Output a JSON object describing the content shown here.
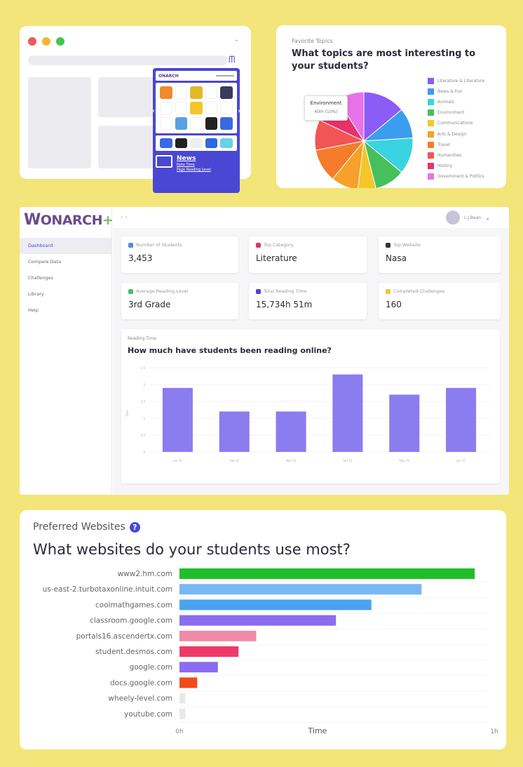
{
  "browser": {
    "ext_brand": "ONARCH",
    "news_title": "News",
    "news_sub1": "Note Time",
    "news_sub2": "Page Reading Level",
    "app_colors": [
      "#f08a2a",
      "#ffffff",
      "#e0b92a",
      "#ffffff",
      "#3a3a5a",
      "#ffffff",
      "#ffffff",
      "#f5c52a",
      "#ffffff",
      "#ffffff",
      "#ffffff",
      "#5aa0e6",
      "#ffffff",
      "#222222",
      "#3a6ae0"
    ],
    "row2_colors": [
      "#3a6ae0",
      "#222222",
      "#eeeeee",
      "#2a6ae0",
      "#6ad0e6"
    ]
  },
  "pie": {
    "label": "Favorite Topics",
    "title": "What topics are most interesting to your students?",
    "tooltip_name": "Environment",
    "tooltip_value": "40m (10%)",
    "legend": [
      {
        "label": "Literature & Literature",
        "color": "#8b5cf6"
      },
      {
        "label": "News & Fun",
        "color": "#3b9ded"
      },
      {
        "label": "Animals",
        "color": "#3ad3e0"
      },
      {
        "label": "Environment",
        "color": "#46c05a"
      },
      {
        "label": "Communications",
        "color": "#f5c52a"
      },
      {
        "label": "Arts & Design",
        "color": "#f5a12a"
      },
      {
        "label": "Travel",
        "color": "#f57c2a"
      },
      {
        "label": "Humanities",
        "color": "#f25555"
      },
      {
        "label": "History",
        "color": "#e8316a"
      },
      {
        "label": "Government & Politics",
        "color": "#e872e8"
      }
    ]
  },
  "dashboard": {
    "logo_main": "ONARCH",
    "logo_plus": "+",
    "nav": "‹   ›",
    "user_name": "L.J Bean",
    "sidebar": [
      "Dashboard",
      "Compare Data",
      "Challenges",
      "Library",
      "Help"
    ],
    "stats": [
      {
        "label": "Number of Students",
        "value": "3,453",
        "icon_color": "#4a90e2"
      },
      {
        "label": "Top Category",
        "value": "Literature",
        "icon_color": "#e8316a"
      },
      {
        "label": "Top Website",
        "value": "Nasa",
        "icon_color": "#333333"
      },
      {
        "label": "Average Reading Level",
        "value": "3rd Grade",
        "icon_color": "#46c05a"
      },
      {
        "label": "Total Reading Time",
        "value": "15,734h 51m",
        "icon_color": "#4a47d4"
      },
      {
        "label": "Completed Challenges",
        "value": "160",
        "icon_color": "#f5c52a"
      }
    ],
    "reading_label": "Reading Time",
    "reading_title": "How much have students been reading online?"
  },
  "chart_data": [
    {
      "type": "pie",
      "title": "What topics are most interesting to your students?",
      "categories": [
        "Literature & Literature",
        "News & Fun",
        "Animals",
        "Environment",
        "Communications",
        "Arts & Design",
        "Travel",
        "Humanities",
        "History",
        "Government & Politics"
      ],
      "values": [
        14,
        10,
        12,
        10,
        6,
        9,
        11,
        10,
        9,
        9
      ],
      "colors": [
        "#8b5cf6",
        "#3b9ded",
        "#3ad3e0",
        "#46c05a",
        "#f5c52a",
        "#f5a12a",
        "#f57c2a",
        "#f25555",
        "#e8316a",
        "#e872e8"
      ]
    },
    {
      "type": "bar",
      "title": "How much have students been reading online?",
      "categories": [
        "Jan 15",
        "Feb 15",
        "Mar 15",
        "Apr 15",
        "May 15",
        "Jun 15"
      ],
      "values": [
        1.9,
        1.2,
        1.2,
        2.3,
        1.7,
        1.9
      ],
      "ylim": [
        0,
        2.5
      ],
      "ylabel": "Time",
      "color": "#8b7cf0"
    },
    {
      "type": "bar",
      "orientation": "horizontal",
      "title": "What websites do your students use most?",
      "categories": [
        "www2.hm.com",
        "us-east-2.turbotaxonline.intuit.com",
        "coolmathgames.com",
        "classroom.google.com",
        "portals16.ascendertx.com",
        "student.desmos.com",
        "google.com",
        "docs.google.com",
        "wheely-level.com",
        "youtube.com"
      ],
      "values": [
        100,
        82,
        65,
        53,
        26,
        20,
        13,
        6,
        2,
        2
      ],
      "colors": [
        "#1fbf2a",
        "#7ab8f5",
        "#4aa3f0",
        "#8b6cf0",
        "#f08aa8",
        "#ee3a6a",
        "#8b6cf0",
        "#f24a1a",
        "#e8e8ee",
        "#e8e8ee"
      ],
      "xlabel": "Time",
      "xlim": [
        0,
        104
      ]
    }
  ],
  "sites": {
    "label": "Preferred Websites",
    "help": "?",
    "title": "What websites do your students use most?",
    "x0": "0h",
    "xlabel": "Time",
    "xmax": "1h"
  }
}
